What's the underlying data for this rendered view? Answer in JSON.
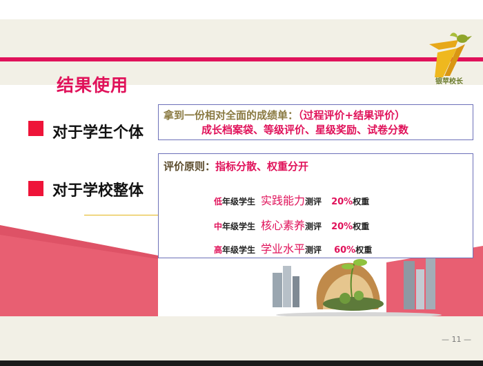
{
  "logo": {
    "caption": "银苹校长"
  },
  "title": "结果使用",
  "bullets": [
    {
      "label": "对于学生个体"
    },
    {
      "label": "对于学校整体"
    }
  ],
  "box1": {
    "line1_prefix": "拿到一份相对全面的成绩单：",
    "line1_accent": "（过程评价+结果评价）",
    "line2": "成长档案袋、等级评价、星级奖励、试卷分数"
  },
  "box2": {
    "principle_label": "评价原则：",
    "principle_value": "指标分散、权重分开",
    "rows": [
      {
        "grade_a": "低",
        "grade_b": "年级学生",
        "skill": "实践能力",
        "test": "测评",
        "pct": "20%",
        "weight": "权重"
      },
      {
        "grade_a": "中",
        "grade_b": "年级学生",
        "skill": "核心素养",
        "test": "测评",
        "pct": "20%",
        "weight": "权重"
      },
      {
        "grade_a": "高",
        "grade_b": "年级学生",
        "skill": "学业水平",
        "test": "测评",
        "pct": "60%",
        "weight": "权重"
      }
    ]
  },
  "footer": {
    "page": "— 11 —"
  },
  "colors": {
    "accent": "#e0125a",
    "bullet": "#ee1439",
    "band": "#f2f0e6",
    "box_border": "#6b6fb8"
  }
}
